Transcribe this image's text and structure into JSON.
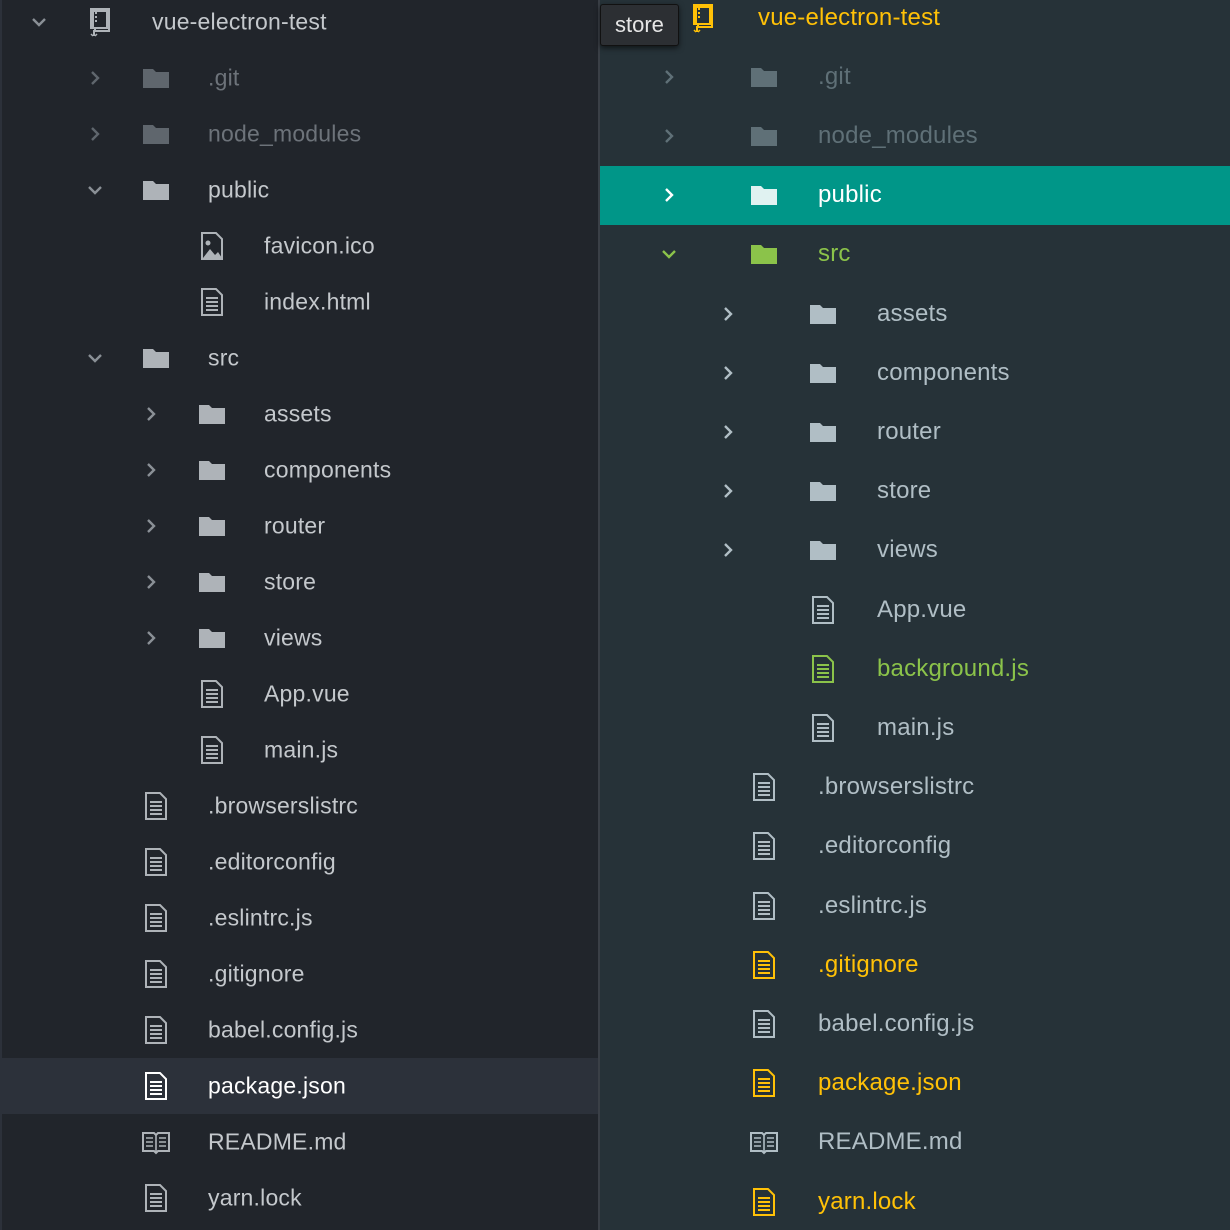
{
  "left_tree": {
    "rows": [
      {
        "label": "vue-electron-test",
        "icon": "repo-icon",
        "chevron": "expanded",
        "depth": 0,
        "state": "normal"
      },
      {
        "label": ".git",
        "icon": "folder-icon",
        "chevron": "collapsed",
        "depth": 1,
        "state": "dim"
      },
      {
        "label": "node_modules",
        "icon": "folder-icon",
        "chevron": "collapsed",
        "depth": 1,
        "state": "dim"
      },
      {
        "label": "public",
        "icon": "folder-icon",
        "chevron": "expanded",
        "depth": 1,
        "state": "normal"
      },
      {
        "label": "favicon.ico",
        "icon": "image-file-icon",
        "chevron": "none",
        "depth": 2,
        "state": "normal"
      },
      {
        "label": "index.html",
        "icon": "file-icon",
        "chevron": "none",
        "depth": 2,
        "state": "normal"
      },
      {
        "label": "src",
        "icon": "folder-icon",
        "chevron": "expanded",
        "depth": 1,
        "state": "normal"
      },
      {
        "label": "assets",
        "icon": "folder-icon",
        "chevron": "collapsed",
        "depth": 2,
        "state": "normal"
      },
      {
        "label": "components",
        "icon": "folder-icon",
        "chevron": "collapsed",
        "depth": 2,
        "state": "normal"
      },
      {
        "label": "router",
        "icon": "folder-icon",
        "chevron": "collapsed",
        "depth": 2,
        "state": "normal"
      },
      {
        "label": "store",
        "icon": "folder-icon",
        "chevron": "collapsed",
        "depth": 2,
        "state": "normal"
      },
      {
        "label": "views",
        "icon": "folder-icon",
        "chevron": "collapsed",
        "depth": 2,
        "state": "normal"
      },
      {
        "label": "App.vue",
        "icon": "file-icon",
        "chevron": "none",
        "depth": 2,
        "state": "normal"
      },
      {
        "label": "main.js",
        "icon": "file-icon",
        "chevron": "none",
        "depth": 2,
        "state": "normal"
      },
      {
        "label": ".browserslistrc",
        "icon": "file-icon",
        "chevron": "none",
        "depth": 1,
        "state": "normal"
      },
      {
        "label": ".editorconfig",
        "icon": "file-icon",
        "chevron": "none",
        "depth": 1,
        "state": "normal"
      },
      {
        "label": ".eslintrc.js",
        "icon": "file-icon",
        "chevron": "none",
        "depth": 1,
        "state": "normal"
      },
      {
        "label": ".gitignore",
        "icon": "file-icon",
        "chevron": "none",
        "depth": 1,
        "state": "normal"
      },
      {
        "label": "babel.config.js",
        "icon": "file-icon",
        "chevron": "none",
        "depth": 1,
        "state": "normal"
      },
      {
        "label": "package.json",
        "icon": "file-icon",
        "chevron": "none",
        "depth": 1,
        "state": "selected"
      },
      {
        "label": "README.md",
        "icon": "book-icon",
        "chevron": "none",
        "depth": 1,
        "state": "normal"
      },
      {
        "label": "yarn.lock",
        "icon": "file-icon",
        "chevron": "none",
        "depth": 1,
        "state": "normal"
      }
    ]
  },
  "right_tree": {
    "rows": [
      {
        "label": "vue-electron-test",
        "icon": "repo-icon",
        "chevron": "none",
        "depth": 0,
        "state": "root"
      },
      {
        "label": ".git",
        "icon": "folder-icon",
        "chevron": "collapsed",
        "depth": 1,
        "state": "dim"
      },
      {
        "label": "node_modules",
        "icon": "folder-icon",
        "chevron": "collapsed",
        "depth": 1,
        "state": "dim"
      },
      {
        "label": "public",
        "icon": "folder-icon",
        "chevron": "collapsed",
        "depth": 1,
        "state": "selected"
      },
      {
        "label": "src",
        "icon": "folder-icon",
        "chevron": "expanded",
        "depth": 1,
        "state": "green"
      },
      {
        "label": "assets",
        "icon": "folder-icon",
        "chevron": "collapsed",
        "depth": 2,
        "state": "normal"
      },
      {
        "label": "components",
        "icon": "folder-icon",
        "chevron": "collapsed",
        "depth": 2,
        "state": "normal"
      },
      {
        "label": "router",
        "icon": "folder-icon",
        "chevron": "collapsed",
        "depth": 2,
        "state": "normal"
      },
      {
        "label": "store",
        "icon": "folder-icon",
        "chevron": "collapsed",
        "depth": 2,
        "state": "normal"
      },
      {
        "label": "views",
        "icon": "folder-icon",
        "chevron": "collapsed",
        "depth": 2,
        "state": "normal"
      },
      {
        "label": "App.vue",
        "icon": "file-icon",
        "chevron": "none",
        "depth": 2,
        "state": "normal"
      },
      {
        "label": "background.js",
        "icon": "file-icon",
        "chevron": "none",
        "depth": 2,
        "state": "green"
      },
      {
        "label": "main.js",
        "icon": "file-icon",
        "chevron": "none",
        "depth": 2,
        "state": "normal"
      },
      {
        "label": ".browserslistrc",
        "icon": "file-icon",
        "chevron": "none",
        "depth": 1,
        "state": "normal"
      },
      {
        "label": ".editorconfig",
        "icon": "file-icon",
        "chevron": "none",
        "depth": 1,
        "state": "normal"
      },
      {
        "label": ".eslintrc.js",
        "icon": "file-icon",
        "chevron": "none",
        "depth": 1,
        "state": "normal"
      },
      {
        "label": ".gitignore",
        "icon": "file-icon",
        "chevron": "none",
        "depth": 1,
        "state": "yellow"
      },
      {
        "label": "babel.config.js",
        "icon": "file-icon",
        "chevron": "none",
        "depth": 1,
        "state": "normal"
      },
      {
        "label": "package.json",
        "icon": "file-icon",
        "chevron": "none",
        "depth": 1,
        "state": "yellow"
      },
      {
        "label": "README.md",
        "icon": "book-icon",
        "chevron": "none",
        "depth": 1,
        "state": "normal"
      },
      {
        "label": "yarn.lock",
        "icon": "file-icon",
        "chevron": "none",
        "depth": 1,
        "state": "yellow"
      }
    ]
  },
  "tooltip": {
    "text": "store"
  },
  "colors": {
    "left_bg": "#21252b",
    "left_selected_bg": "#2c313a",
    "right_bg": "#263238",
    "right_selected_bg": "#009688",
    "git_added": "#8bc34a",
    "git_modified": "#ffc107"
  }
}
